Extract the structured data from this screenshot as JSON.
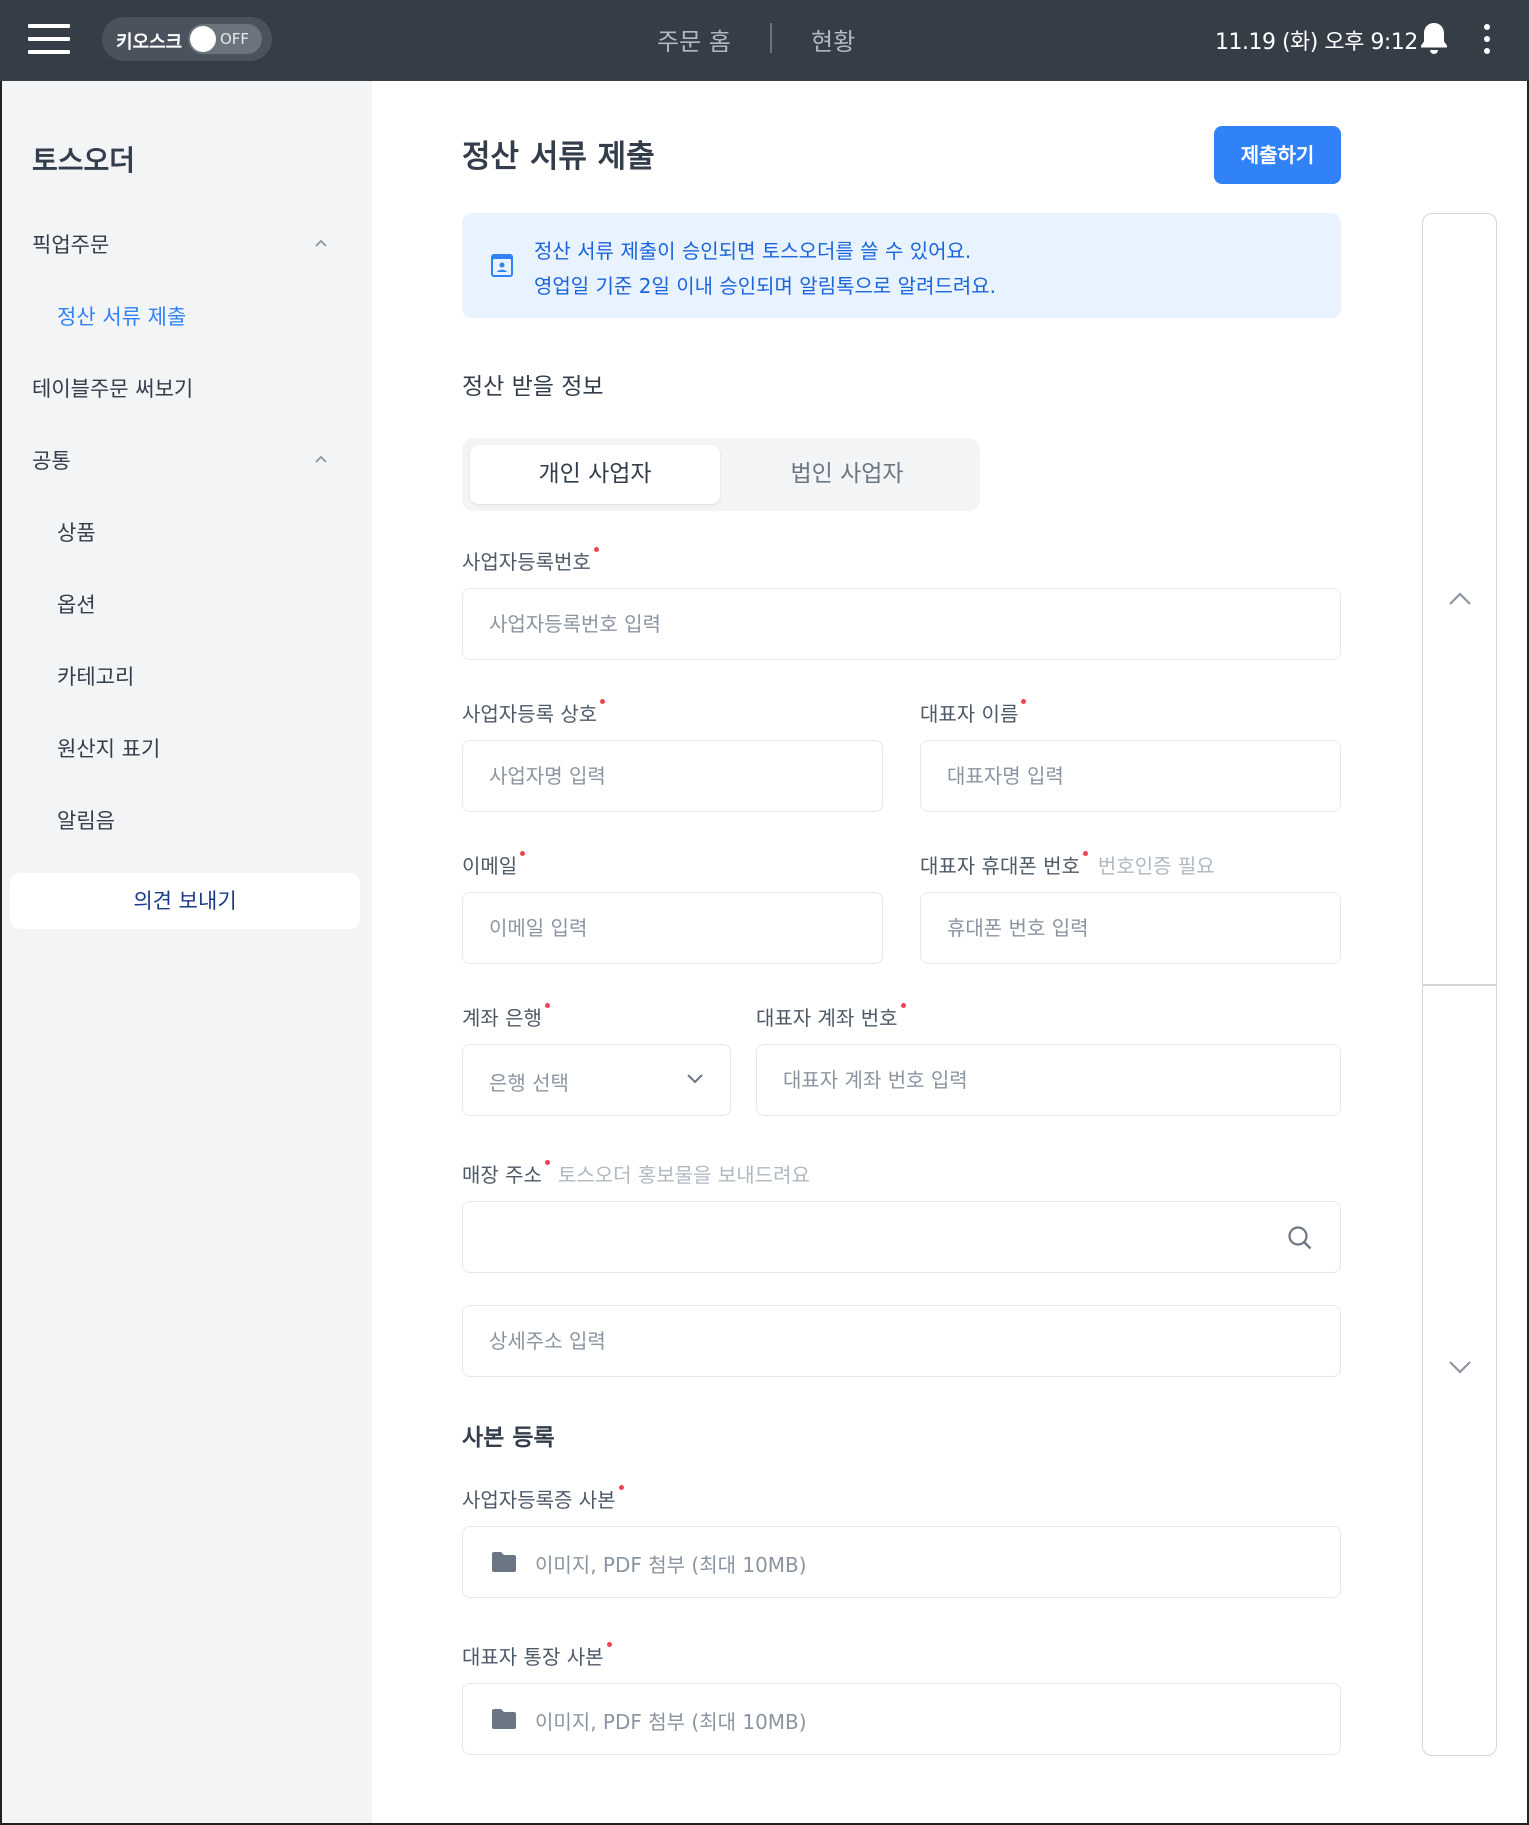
{
  "topbar": {
    "kiosk_label": "키오스크",
    "kiosk_toggle_state": "OFF",
    "nav_home": "주문 홈",
    "nav_status": "현황",
    "datetime": "11.19 (화) 오후 9:12"
  },
  "sidebar": {
    "brand": "토스오더",
    "items": [
      {
        "label": "픽업주문"
      },
      {
        "label": "정산 서류 제출"
      },
      {
        "label": "테이블주문 써보기"
      },
      {
        "label": "공통"
      },
      {
        "label": "상품"
      },
      {
        "label": "옵션"
      },
      {
        "label": "카테고리"
      },
      {
        "label": "원산지 표기"
      },
      {
        "label": "알림음"
      }
    ],
    "feedback_label": "의견 보내기"
  },
  "main": {
    "title": "정산 서류 제출",
    "submit_label": "제출하기",
    "notice": {
      "line1": "정산 서류 제출이 승인되면 토스오더를 쓸 수 있어요.",
      "line2": "영업일 기준 2일 이내 승인되며 알림톡으로 알려드려요."
    },
    "section_info_title": "정산 받을 정보",
    "tabs": [
      "개인 사업자",
      "법인 사업자"
    ],
    "fields": {
      "biz_number": {
        "label": "사업자등록번호",
        "placeholder": "사업자등록번호 입력"
      },
      "biz_name": {
        "label": "사업자등록 상호",
        "placeholder": "사업자명 입력"
      },
      "rep_name": {
        "label": "대표자 이름",
        "placeholder": "대표자명 입력"
      },
      "email": {
        "label": "이메일",
        "placeholder": "이메일 입력"
      },
      "rep_phone": {
        "label": "대표자 휴대폰 번호",
        "hint": "번호인증 필요",
        "placeholder": "휴대폰 번호 입력"
      },
      "bank": {
        "label": "계좌 은행",
        "placeholder": "은행 선택"
      },
      "account": {
        "label": "대표자 계좌 번호",
        "placeholder": "대표자 계좌 번호 입력"
      },
      "address": {
        "label": "매장 주소",
        "hint": "토스오더 홍보물을 보내드려요",
        "value": "",
        "detail_placeholder": "상세주소 입력"
      }
    },
    "section_copy_title": "사본 등록",
    "uploads": {
      "biz_cert": {
        "label": "사업자등록증 사본",
        "text": "이미지, PDF 첨부 (최대 10MB)"
      },
      "bankbook": {
        "label": "대표자 통장 사본",
        "text": "이미지, PDF 첨부 (최대 10MB)"
      }
    }
  },
  "colors": {
    "topbar": "#353d47",
    "accent": "#3182f6",
    "notice_bg": "#e8f3ff",
    "required": "#f04452"
  }
}
